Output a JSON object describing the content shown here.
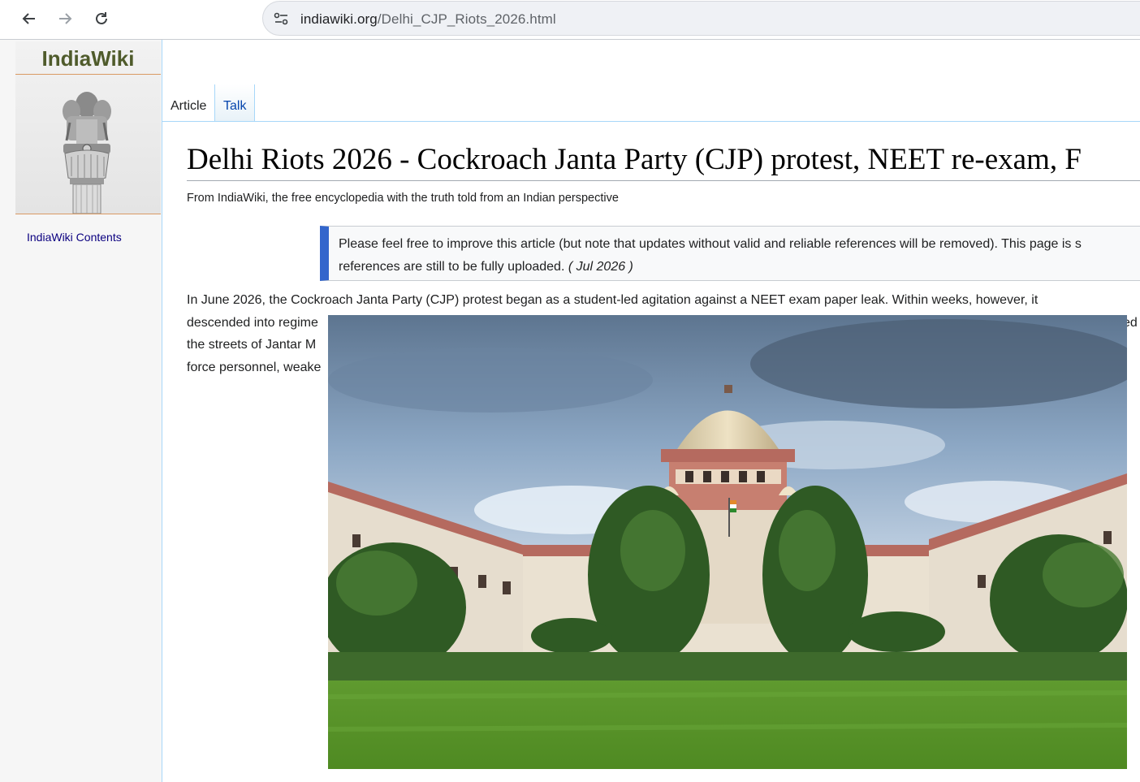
{
  "browser": {
    "url_domain": "indiawiki.org",
    "url_path": "/Delhi_CJP_Riots_2026.html",
    "icons": [
      "back-arrow-icon",
      "forward-arrow-icon",
      "reload-icon",
      "site-info-icon"
    ]
  },
  "sidebar": {
    "logo_text": "IndiaWiki",
    "logo_icon": "ashoka-lion-emblem-icon",
    "contents_link": "IndiaWiki Contents"
  },
  "tabs": [
    {
      "label": "Article"
    },
    {
      "label": "Talk"
    }
  ],
  "article": {
    "title": "Delhi Riots 2026 - Cockroach Janta Party (CJP) protest, NEET re-exam, F",
    "tagline": "From IndiaWiki, the free encyclopedia with the truth told from an Indian perspective",
    "notice": {
      "line1": "Please feel free to improve this article (but note that updates without valid and reliable references will be removed). This page is s",
      "line2": "references are still to be fully uploaded.",
      "date": "( Jul 2026 )"
    },
    "paragraph": {
      "line1": "In June 2026, the Cockroach Janta Party (CJP) protest began as a student-led agitation against a NEET exam paper leak. Within weeks, however, it",
      "line2": "descended into regime",
      "line2_end": "ed",
      "line3": "the streets of Jantar M",
      "line4": "force personnel, weake"
    },
    "image_description_icon": "supreme-court-building-photo"
  },
  "colors": {
    "link": "#0645ad",
    "notice_accent": "#3366cc",
    "logo_green": "#4f5b2b",
    "sidebar_bg": "#f6f6f6"
  }
}
